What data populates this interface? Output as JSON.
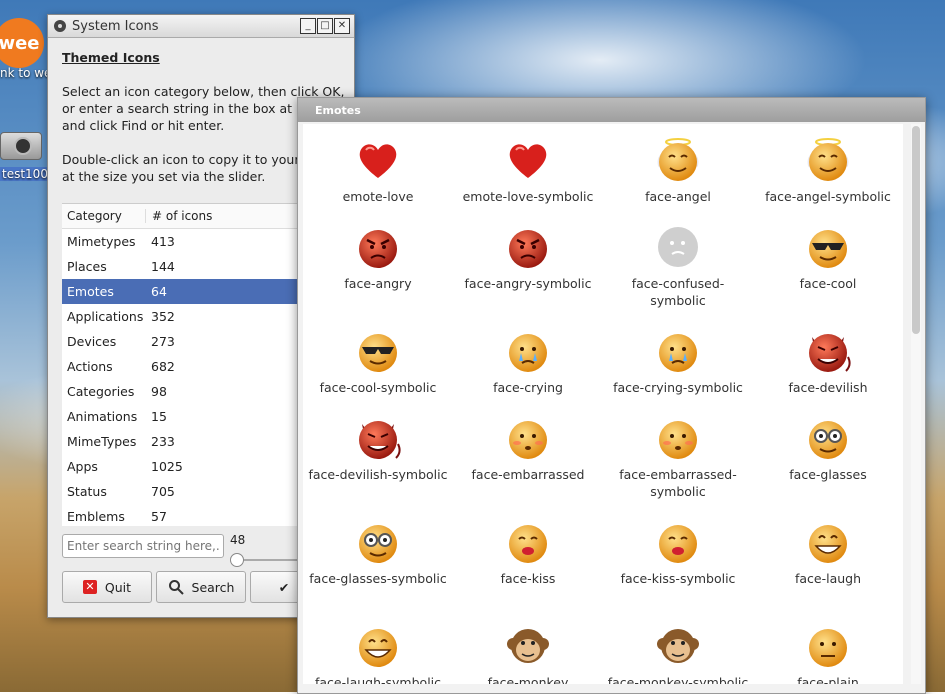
{
  "desktop": {
    "launcher_label": "wee",
    "launcher_caption": "nk to we",
    "camera_label": "test100"
  },
  "system_icons": {
    "title": "System Icons",
    "heading": "Themed Icons",
    "para1_line1": "Select an icon category below, then click OK,",
    "para1_line2": "or enter a search string in the box at botto",
    "para1_line3": "and click Find or hit enter.",
    "para2_line1": "Double-click an icon to copy it to your hom",
    "para2_line2": "at the size you set via the slider.",
    "table": {
      "headers": [
        "Category",
        "# of icons"
      ],
      "rows": [
        {
          "category": "Mimetypes",
          "count": "413"
        },
        {
          "category": "Places",
          "count": "144"
        },
        {
          "category": "Emotes",
          "count": "64"
        },
        {
          "category": "Applications",
          "count": "352"
        },
        {
          "category": "Devices",
          "count": "273"
        },
        {
          "category": "Actions",
          "count": "682"
        },
        {
          "category": "Categories",
          "count": "98"
        },
        {
          "category": "Animations",
          "count": "15"
        },
        {
          "category": "MimeTypes",
          "count": "233"
        },
        {
          "category": "Apps",
          "count": "1025"
        },
        {
          "category": "Status",
          "count": "705"
        },
        {
          "category": "Emblems",
          "count": "57"
        }
      ],
      "selected": "Emotes"
    },
    "search_placeholder": "Enter search string here,...",
    "slider_value": "48",
    "buttons": {
      "quit": "Quit",
      "search": "Search",
      "ok": "✔"
    }
  },
  "emotes": {
    "title": "Emotes",
    "icons": [
      {
        "label": "emote-love",
        "kind": "heart-icon"
      },
      {
        "label": "emote-love-symbolic",
        "kind": "heart-icon"
      },
      {
        "label": "face-angel",
        "kind": "angel-face-icon"
      },
      {
        "label": "face-angel-symbolic",
        "kind": "angel-face-icon"
      },
      {
        "label": "face-angry",
        "kind": "angry-face-icon"
      },
      {
        "label": "face-angry-symbolic",
        "kind": "angry-face-icon"
      },
      {
        "label": "face-confused-symbolic",
        "kind": "confused-face-icon"
      },
      {
        "label": "face-cool",
        "kind": "cool-face-icon"
      },
      {
        "label": "face-cool-symbolic",
        "kind": "cool-face-icon"
      },
      {
        "label": "face-crying",
        "kind": "crying-face-icon"
      },
      {
        "label": "face-crying-symbolic",
        "kind": "crying-face-icon"
      },
      {
        "label": "face-devilish",
        "kind": "devilish-face-icon"
      },
      {
        "label": "face-devilish-symbolic",
        "kind": "devilish-face-icon"
      },
      {
        "label": "face-embarrassed",
        "kind": "embarrassed-face-icon"
      },
      {
        "label": "face-embarrassed-symbolic",
        "kind": "embarrassed-face-icon"
      },
      {
        "label": "face-glasses",
        "kind": "glasses-face-icon"
      },
      {
        "label": "face-glasses-symbolic",
        "kind": "glasses-face-icon"
      },
      {
        "label": "face-kiss",
        "kind": "kiss-face-icon"
      },
      {
        "label": "face-kiss-symbolic",
        "kind": "kiss-face-icon"
      },
      {
        "label": "face-laugh",
        "kind": "laugh-face-icon"
      },
      {
        "label": "face-laugh-symbolic",
        "kind": "laugh-face-icon"
      },
      {
        "label": "face-monkey",
        "kind": "monkey-face-icon"
      },
      {
        "label": "face-monkey-symbolic",
        "kind": "monkey-face-icon"
      },
      {
        "label": "face-plain",
        "kind": "plain-face-icon"
      }
    ]
  },
  "colors": {
    "selection": "#4a6db5",
    "face_orange": "#f0a020",
    "face_red": "#c0281a",
    "heart_red": "#d8201c"
  }
}
